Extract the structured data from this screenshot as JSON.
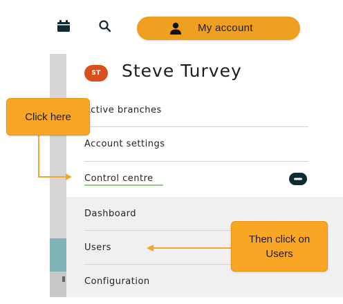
{
  "topbar": {
    "calendar_icon": "calendar-icon",
    "search_icon": "search-icon",
    "account_label": "My account",
    "account_icon": "person-icon",
    "accent_color": "#ef9f20"
  },
  "profile": {
    "initials": "ST",
    "name": "Steve Turvey",
    "avatar_color": "#d94f1e"
  },
  "menu": {
    "items": [
      {
        "label": "Active branches"
      },
      {
        "label": "Account settings"
      },
      {
        "label": "Control centre"
      }
    ],
    "collapse_icon": "minus-circle-icon"
  },
  "submenu": {
    "items": [
      {
        "label": "Dashboard"
      },
      {
        "label": "Users"
      },
      {
        "label": "Configuration"
      }
    ]
  },
  "callouts": {
    "first": "Click here",
    "second_line1": "Then click on",
    "second_line2": "Users",
    "color": "#f8a623"
  }
}
